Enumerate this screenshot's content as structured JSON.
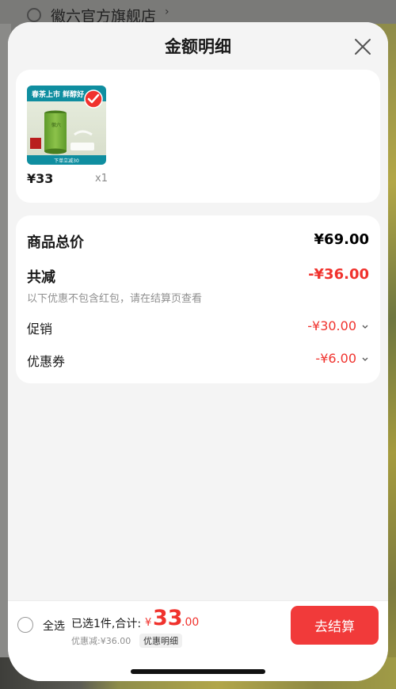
{
  "background": {
    "store_name": "徽六官方旗舰店",
    "store_chevron": "›"
  },
  "sheet": {
    "title": "金额明细"
  },
  "product": {
    "image_banner_text": "春茶上市 鲜醇好",
    "image_footer_text": "下单立减30",
    "image_can_text": "徽六",
    "price": "¥33",
    "quantity": "x1"
  },
  "summary": {
    "total_label": "商品总价",
    "total_value": "¥69.00",
    "reduce_label": "共减",
    "reduce_value": "-¥36.00",
    "note": "以下优惠不包含红包，请在结算页查看",
    "promo_label": "促销",
    "promo_value": "-¥30.00",
    "coupon_label": "优惠券",
    "coupon_value": "-¥6.00"
  },
  "bottom_bar": {
    "select_all_label": "全选",
    "selected_text": "已选1件,合计:",
    "total_currency": "¥",
    "total_integer": "33",
    "total_decimal": ".00",
    "discount_text": "优惠减:¥36.00",
    "detail_button": "优惠明细",
    "checkout_button": "去结算"
  },
  "colors": {
    "accent_red": "#f0322d",
    "checkout_red": "#f13a3a",
    "product_green": "#7db33c",
    "product_teal": "#0f8ea0"
  }
}
